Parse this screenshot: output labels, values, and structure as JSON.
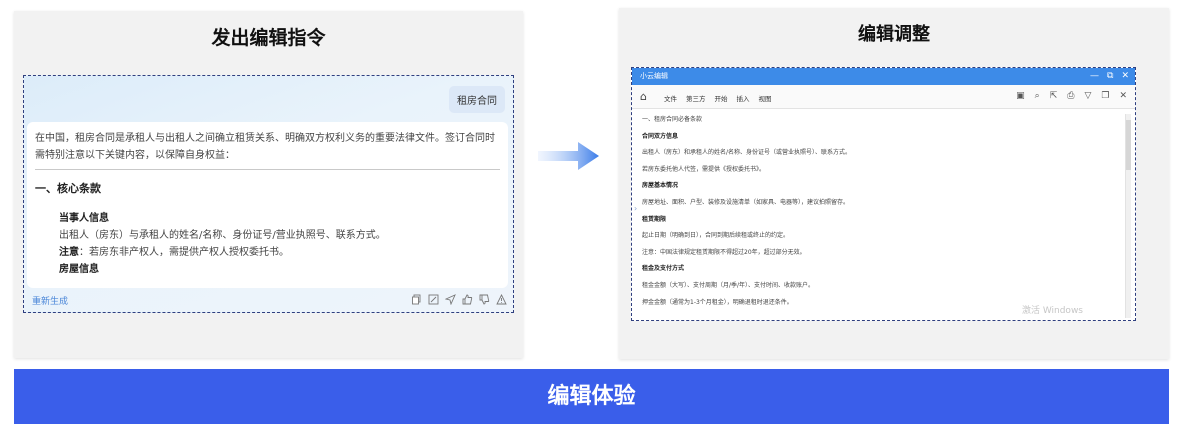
{
  "left_panel": {
    "title": "发出编辑指令",
    "user_message": "租房合同",
    "answer": {
      "intro": "在中国，租房合同是承租人与出租人之间确立租赁关系、明确双方权利义务的重要法律文件。签订合同时需特别注意以下关键内容，以保障自身权益：",
      "section_heading": "一、核心条款",
      "sub_heading_1": "当事人信息",
      "line_1": "出租人（房东）与承租人的姓名/名称、身份证号/营业执照号、联系方式。",
      "note_label": "注意",
      "note_text": "：若房东非产权人，需提供产权人授权委托书。",
      "sub_heading_2": "房屋信息"
    },
    "regenerate_label": "重新生成",
    "action_icons": [
      "copy-icon",
      "edit-icon",
      "share-icon",
      "thumbs-up-icon",
      "thumbs-down-icon",
      "warning-icon"
    ]
  },
  "right_panel": {
    "title": "编辑调整",
    "editor": {
      "window_title": "小云编辑",
      "menu": [
        "文件",
        "第三方",
        "开始",
        "插入",
        "视图"
      ],
      "doc_lines": [
        {
          "text": "一、租房合同必备条款",
          "bold": false
        },
        {
          "text": "合同双方信息",
          "bold": true
        },
        {
          "text": "出租人（房东）和承租人的姓名/名称、身份证号（或营业执照号）、联系方式。",
          "bold": false
        },
        {
          "text": "若房东委托他人代签，需提供《授权委托书》。",
          "bold": false
        },
        {
          "text": "房屋基本情况",
          "bold": true
        },
        {
          "text": "房屋地址、面积、户型、装修及设施清单（如家具、电器等），建议拍照留存。",
          "bold": false
        },
        {
          "text": "租赁期限",
          "bold": true
        },
        {
          "text": "起止日期（明确到日），合同到期后续租或终止的约定。",
          "bold": false
        },
        {
          "text": "注意：中国法律规定租赁期限不得超过20年，超过部分无效。",
          "bold": false
        },
        {
          "text": "租金及支付方式",
          "bold": true
        },
        {
          "text": "租金金额（大写）、支付周期（月/季/年）、支付时间、收款账户。",
          "bold": false
        },
        {
          "text": "押金金额（通常为1-3个月租金），明确退租时退还条件。",
          "bold": false
        }
      ],
      "watermark": "激活 Windows"
    }
  },
  "banner_text": "编辑体验",
  "colors": {
    "banner": "#3a5eea",
    "editor_titlebar": "#3d8be8",
    "dashed_border": "#2f3f7f",
    "link": "#4a86d8"
  }
}
